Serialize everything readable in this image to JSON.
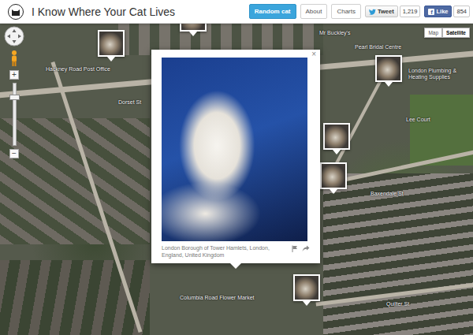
{
  "header": {
    "title": "I Know Where Your Cat Lives",
    "nav": [
      {
        "label": "Random cat",
        "kind": "primary"
      },
      {
        "label": "About",
        "kind": "plain"
      },
      {
        "label": "Charts",
        "kind": "plain"
      }
    ],
    "social": [
      {
        "kind": "tweet",
        "icon": "",
        "label": "Tweet",
        "count": "1,219"
      },
      {
        "kind": "like",
        "icon": "f",
        "label": "Like",
        "count": "854"
      }
    ]
  },
  "map_controls": {
    "zoom_in": "+",
    "zoom_out": "−",
    "map_types": [
      {
        "label": "Map",
        "selected": false
      },
      {
        "label": "Satellite",
        "selected": true
      }
    ]
  },
  "popup": {
    "close": "×",
    "caption": "London Borough of Tower Hamlets, London, England, United Kingdom"
  },
  "pins": [
    {
      "kind": "photo"
    },
    {
      "kind": "photo"
    },
    {
      "kind": "photo"
    },
    {
      "kind": "photo"
    },
    {
      "kind": "photo"
    },
    {
      "kind": "photo"
    }
  ],
  "map_labels": [
    "Hackney Road Post Office",
    "Dorset St",
    "Mr Buckley's",
    "Pearl Bridal Centre",
    "London Plumbing & Heating Supplies",
    "Lee Court",
    "Baxendale St",
    "Quilter St",
    "Columbia Road Flower Market"
  ]
}
